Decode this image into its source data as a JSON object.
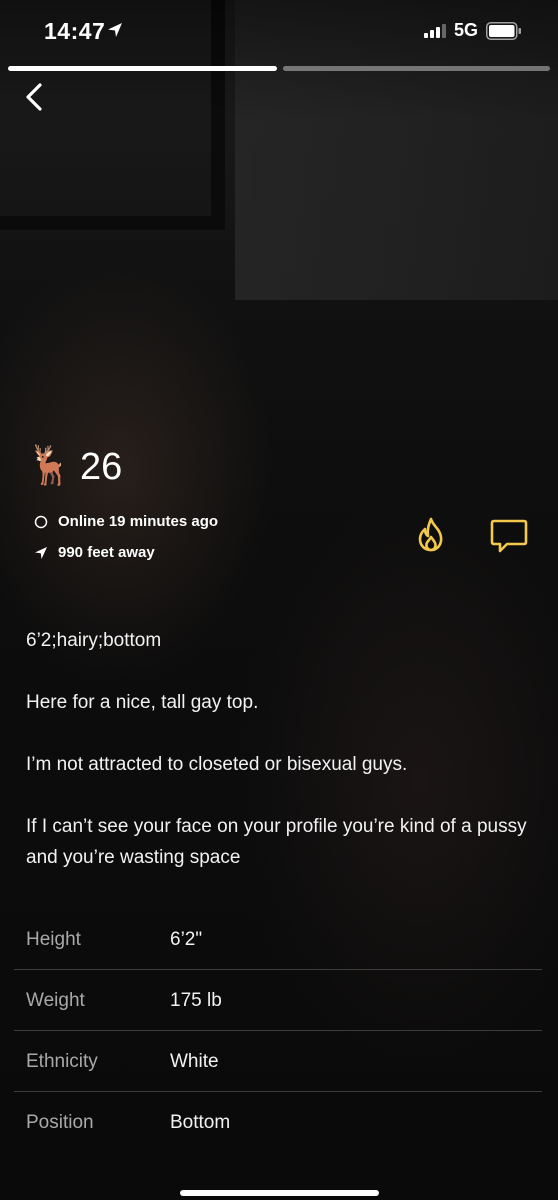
{
  "status_bar": {
    "time": "14:47",
    "network": "5G",
    "location_icon": "location-arrow-icon",
    "signal_icon": "cellular-signal-icon",
    "battery_icon": "battery-icon"
  },
  "story_progress": {
    "segments": 2,
    "active_segment": 1
  },
  "navigation": {
    "back_icon": "chevron-left-icon"
  },
  "profile": {
    "emoji": "🦌",
    "age": "26",
    "online_status": "Online 19 minutes ago",
    "distance": "990 feet away",
    "online_icon": "circle-outline-icon",
    "distance_icon": "location-arrow-icon"
  },
  "actions": {
    "tap_icon": "flame-icon",
    "chat_icon": "chat-bubble-icon",
    "accent_color": "#F2C94C"
  },
  "bio": {
    "tagline": "6’2;hairy;bottom",
    "paragraphs": [
      "Here for a nice, tall gay top.",
      "I’m not attracted to closeted or bisexual guys.",
      "If I can’t see your face on your profile you’re kind of a pussy and you’re wasting space"
    ]
  },
  "stats": [
    {
      "label": "Height",
      "value": "6’2\""
    },
    {
      "label": "Weight",
      "value": "175 lb"
    },
    {
      "label": "Ethnicity",
      "value": "White"
    },
    {
      "label": "Position",
      "value": "Bottom"
    }
  ]
}
